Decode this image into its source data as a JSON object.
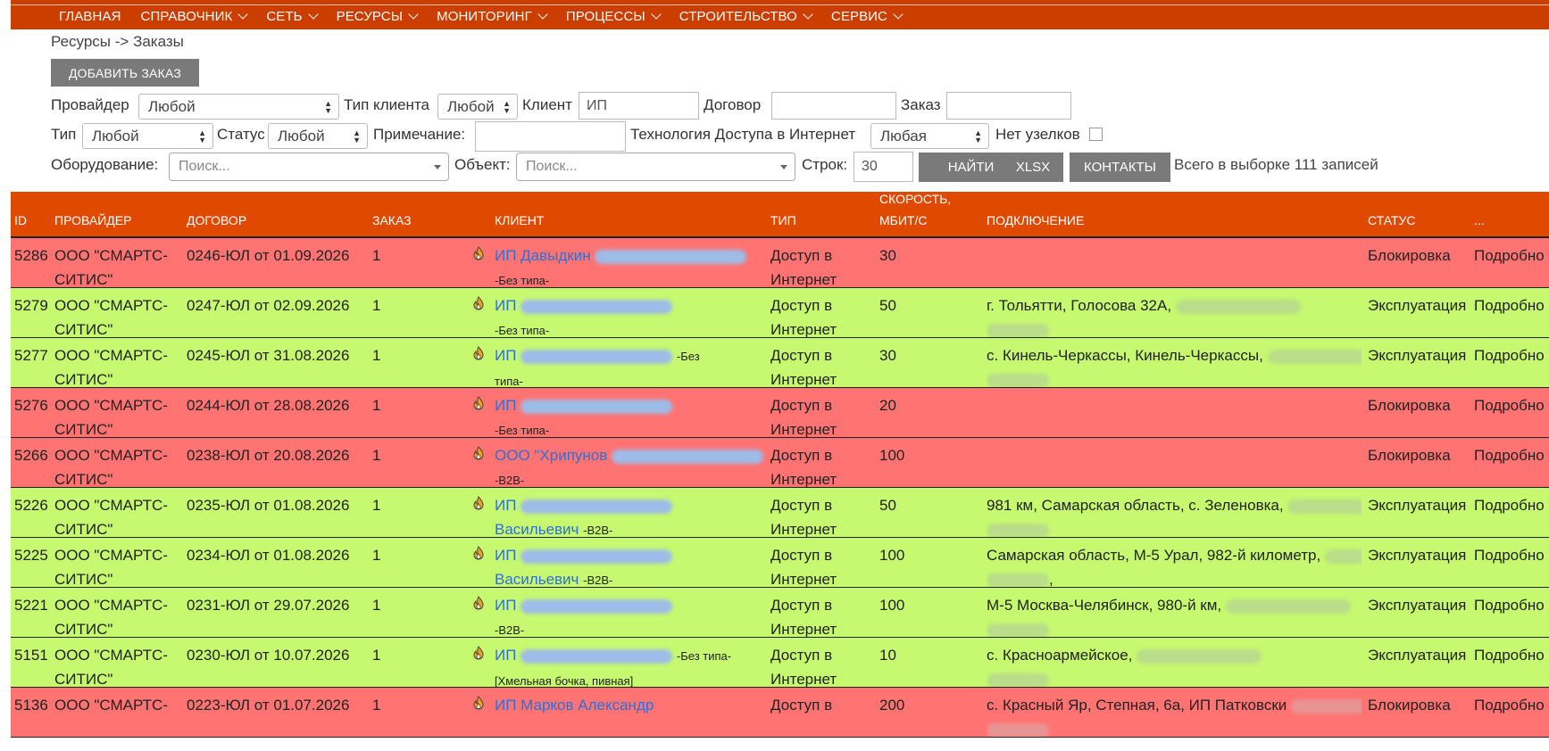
{
  "nav": {
    "items": [
      {
        "label": "ГЛАВНАЯ",
        "has_dropdown": false
      },
      {
        "label": "СПРАВОЧНИК",
        "has_dropdown": true
      },
      {
        "label": "СЕТЬ",
        "has_dropdown": true
      },
      {
        "label": "РЕСУРСЫ",
        "has_dropdown": true
      },
      {
        "label": "МОНИТОРИНГ",
        "has_dropdown": true
      },
      {
        "label": "ПРОЦЕССЫ",
        "has_dropdown": true
      },
      {
        "label": "СТРОИТЕЛЬСТВО",
        "has_dropdown": true
      },
      {
        "label": "СЕРВИС",
        "has_dropdown": true
      }
    ]
  },
  "breadcrumb": "Ресурсы -> Заказы",
  "add_button": "ДОБАВИТЬ ЗАКАЗ",
  "filters": {
    "provider_label": "Провайдер",
    "provider_value": "Любой",
    "client_type_label": "Тип клиента",
    "client_type_value": "Любой",
    "client_label": "Клиент",
    "client_value": "ИП",
    "contract_label": "Договор",
    "contract_value": "",
    "order_label": "Заказ",
    "order_value": "",
    "type_label": "Тип",
    "type_value": "Любой",
    "status_label": "Статус",
    "status_value": "Любой",
    "note_label": "Примечание:",
    "note_value": "",
    "tech_label": "Технология Доступа в Интернет",
    "tech_value": "Любая",
    "no_nodes_label": "Нет узелков",
    "equipment_label": "Оборудование:",
    "equipment_placeholder": "Поиск...",
    "object_label": "Объект:",
    "object_placeholder": "Поиск...",
    "rows_label": "Строк:",
    "rows_value": "30",
    "find_button": "НАЙТИ",
    "xlsx_button": "XLSX",
    "contacts_button": "КОНТАКТЫ",
    "total": "Всего в выборке 111 записей"
  },
  "table": {
    "headers": {
      "id": "ID",
      "provider": "ПРОВАЙДЕР",
      "contract": "ДОГОВОР",
      "order": "ЗАКАЗ",
      "client": "КЛИЕНТ",
      "type": "ТИП",
      "speed_1": "СКОРОСТЬ,",
      "speed_2": "МБИТ/С",
      "connection": "ПОДКЛЮЧЕНИЕ",
      "status": "СТАТУС",
      "more": "..."
    },
    "colors": {
      "blocked": "#ff7373",
      "active": "#c6f96f",
      "header": "#e04a00"
    },
    "rows": [
      {
        "id": "5286",
        "provider_1": "ООО \"СМАРТС-",
        "provider_2": "СИТИС\"",
        "contract": "0246-ЮЛ от 01.09.2026",
        "order": "1",
        "client_text": "ИП Давыдкин",
        "client_blur": true,
        "client_line2": "",
        "client_tag": "-Без типа-",
        "type_1": "Доступ в",
        "type_2": "Интернет",
        "speed": "30",
        "conn_1": "",
        "conn_2": "",
        "status": "Блокировка",
        "more": "Подробно",
        "state": "blocked"
      },
      {
        "id": "5279",
        "provider_1": "ООО \"СМАРТС-",
        "provider_2": "СИТИС\"",
        "contract": "0247-ЮЛ от 02.09.2026",
        "order": "1",
        "client_text": "ИП",
        "client_blur": true,
        "client_line2": "",
        "client_tag": "-Без типа-",
        "type_1": "Доступ в",
        "type_2": "Интернет",
        "speed": "50",
        "conn_1": "г. Тольятти, Голосова 32А,",
        "conn_2": "",
        "status": "Эксплуатация",
        "more": "Подробно",
        "state": "active"
      },
      {
        "id": "5277",
        "provider_1": "ООО \"СМАРТС-",
        "provider_2": "СИТИС\"",
        "contract": "0245-ЮЛ от 31.08.2026",
        "order": "1",
        "client_text": "ИП",
        "client_blur": true,
        "client_line2": "типа-",
        "client_tag": "-Без",
        "type_1": "Доступ в",
        "type_2": "Интернет",
        "speed": "30",
        "conn_1": "с. Кинель-Черкассы, Кинель-Черкассы,",
        "conn_2": "",
        "status": "Эксплуатация",
        "more": "Подробно",
        "state": "active"
      },
      {
        "id": "5276",
        "provider_1": "ООО \"СМАРТС-",
        "provider_2": "СИТИС\"",
        "contract": "0244-ЮЛ от 28.08.2026",
        "order": "1",
        "client_text": "ИП",
        "client_blur": true,
        "client_line2": "",
        "client_tag": "-Без типа-",
        "type_1": "Доступ в",
        "type_2": "Интернет",
        "speed": "20",
        "conn_1": "",
        "conn_2": "",
        "status": "Блокировка",
        "more": "Подробно",
        "state": "blocked"
      },
      {
        "id": "5266",
        "provider_1": "ООО \"СМАРТС-",
        "provider_2": "СИТИС\"",
        "contract": "0238-ЮЛ от 20.08.2026",
        "order": "1",
        "client_text": "ООО \"Хрипунов",
        "client_blur": true,
        "client_line2": "",
        "client_tag": "-B2B-",
        "type_1": "Доступ в",
        "type_2": "Интернет",
        "speed": "100",
        "conn_1": "",
        "conn_2": "",
        "status": "Блокировка",
        "more": "Подробно",
        "state": "blocked"
      },
      {
        "id": "5226",
        "provider_1": "ООО \"СМАРТС-",
        "provider_2": "СИТИС\"",
        "contract": "0235-ЮЛ от 01.08.2026",
        "order": "1",
        "client_text": "ИП",
        "client_blur": true,
        "client_line2": "Васильевич",
        "client_tag": "-B2B-",
        "type_1": "Доступ в",
        "type_2": "Интернет",
        "speed": "50",
        "conn_1": "981 км, Самарская область, с. Зеленовка,",
        "conn_2": "",
        "status": "Эксплуатация",
        "more": "Подробно",
        "state": "active"
      },
      {
        "id": "5225",
        "provider_1": "ООО \"СМАРТС-",
        "provider_2": "СИТИС\"",
        "contract": "0234-ЮЛ от 01.08.2026",
        "order": "1",
        "client_text": "ИП",
        "client_blur": true,
        "client_line2": "Васильевич",
        "client_tag": "-B2B-",
        "type_1": "Доступ в",
        "type_2": "Интернет",
        "speed": "100",
        "conn_1": "Самарская область, М-5 Урал, 982-й километр,",
        "conn_2": ",",
        "status": "Эксплуатация",
        "more": "Подробно",
        "state": "active"
      },
      {
        "id": "5221",
        "provider_1": "ООО \"СМАРТС-",
        "provider_2": "СИТИС\"",
        "contract": "0231-ЮЛ от 29.07.2026",
        "order": "1",
        "client_text": "ИП",
        "client_blur": true,
        "client_line2": "",
        "client_tag": "-B2B-",
        "type_1": "Доступ в",
        "type_2": "Интернет",
        "speed": "100",
        "conn_1": "М-5 Москва-Челябинск, 980-й км,",
        "conn_2": "",
        "status": "Эксплуатация",
        "more": "Подробно",
        "state": "active"
      },
      {
        "id": "5151",
        "provider_1": "ООО \"СМАРТС-",
        "provider_2": "СИТИС\"",
        "contract": "0230-ЮЛ от 10.07.2026",
        "order": "1",
        "client_text": "ИП",
        "client_blur": true,
        "client_line2": "[Хмельная бочка, пивная]",
        "client_tag": "-Без типа-",
        "type_1": "Доступ в",
        "type_2": "Интернет",
        "speed": "10",
        "conn_1": "с. Красноармейское,",
        "conn_2": "",
        "status": "Эксплуатация",
        "more": "Подробно",
        "state": "active"
      },
      {
        "id": "5136",
        "provider_1": "ООО \"СМАРТС-",
        "provider_2": "",
        "contract": "0223-ЮЛ от 01.07.2026",
        "order": "1",
        "client_text": "ИП Марков Александр",
        "client_blur": false,
        "client_line2": "",
        "client_tag": "",
        "type_1": "Доступ в",
        "type_2": "",
        "speed": "200",
        "conn_1": "с. Красный Яр, Степная, 6а, ИП Патковски",
        "conn_2": "",
        "status": "Блокировка",
        "more": "Подробно",
        "state": "blocked"
      }
    ]
  }
}
